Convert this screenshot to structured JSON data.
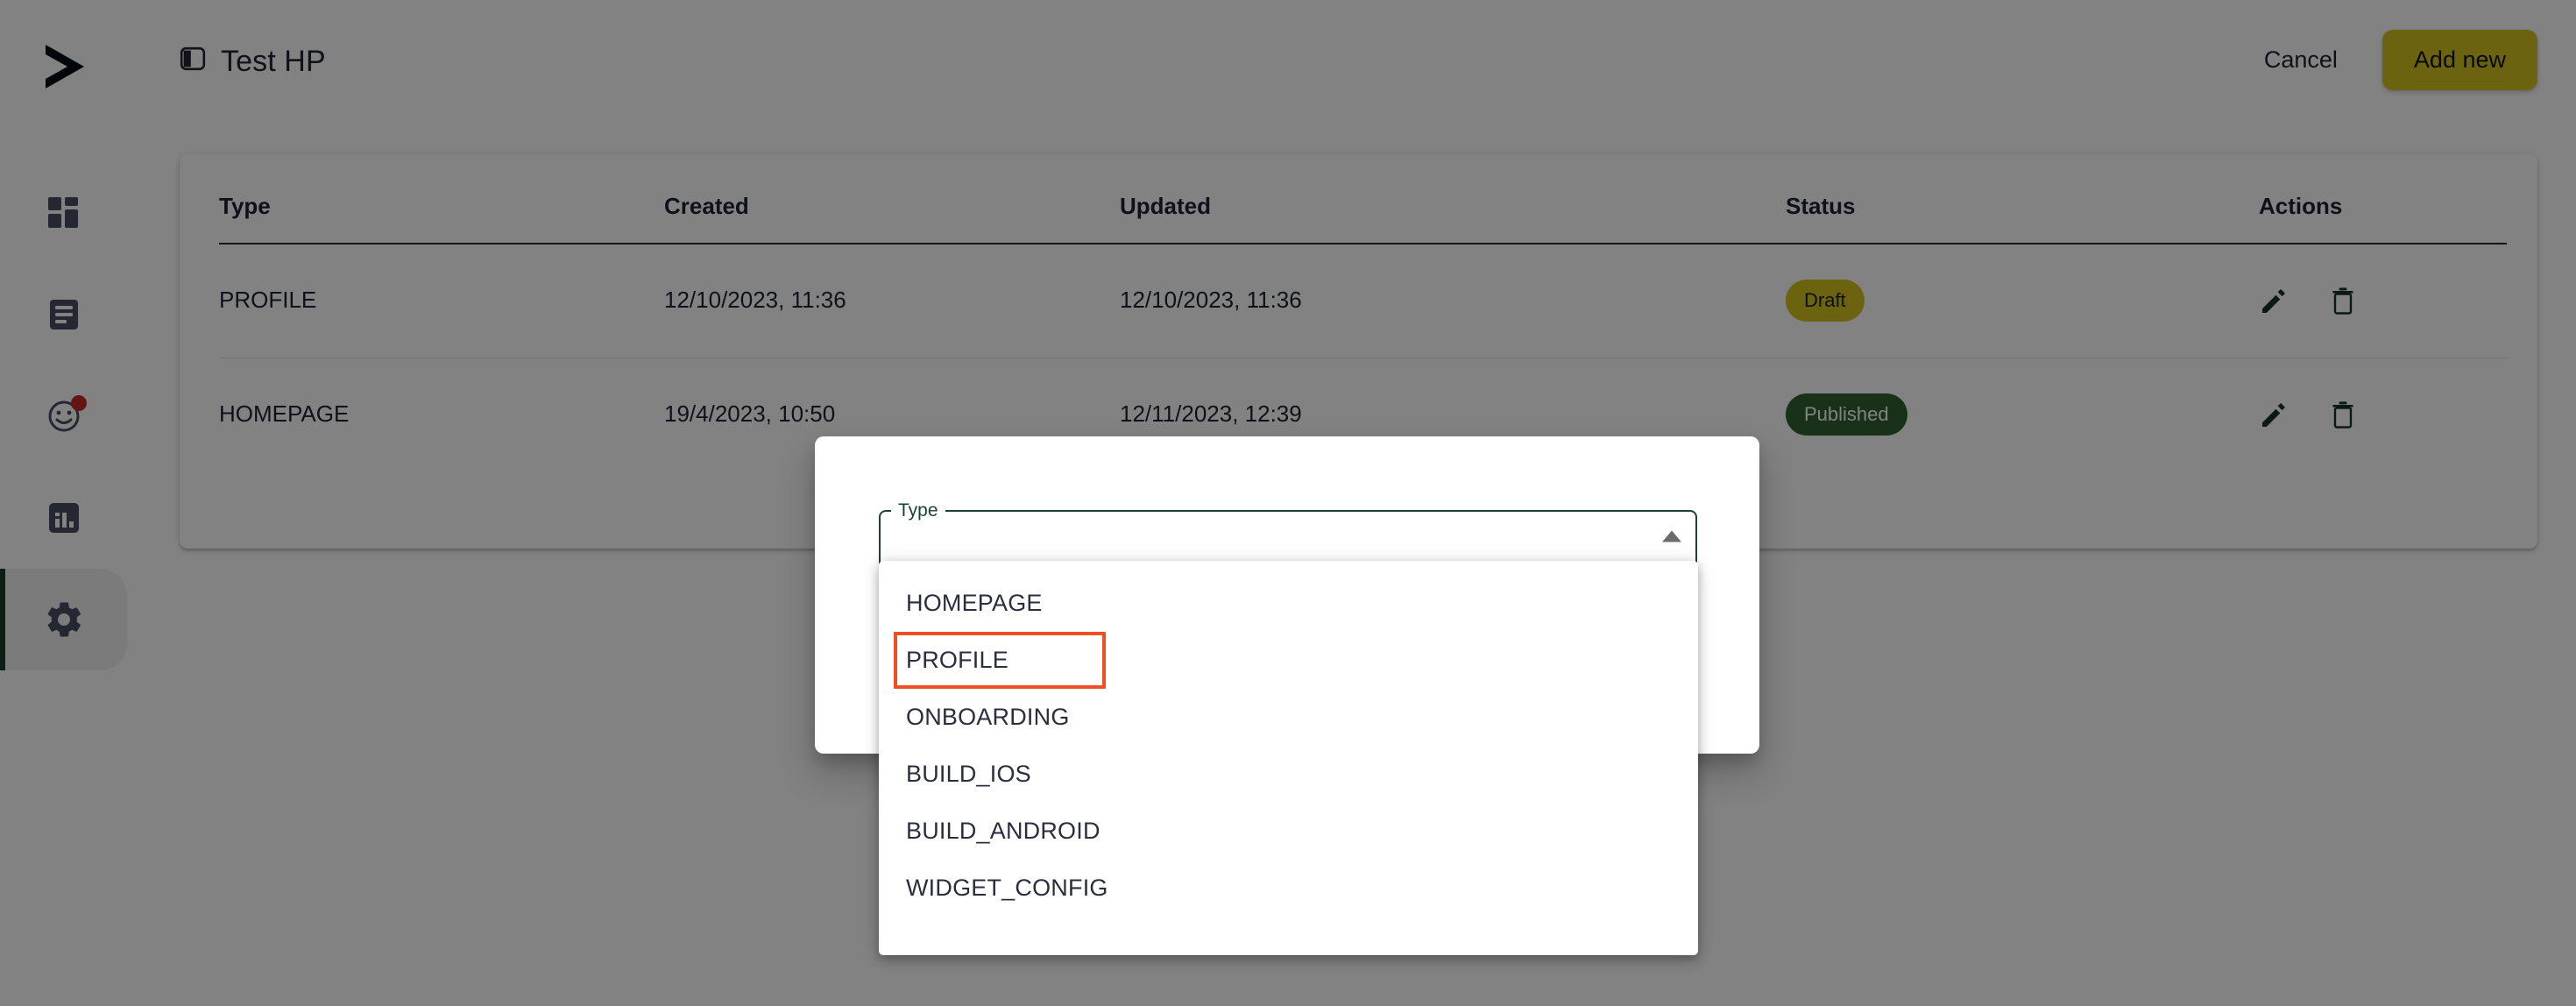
{
  "app": {
    "logo_icon": "play-triangle-logo"
  },
  "sidebar": {
    "items": [
      {
        "id": "dashboard",
        "icon": "dashboard-grid-icon",
        "active": false,
        "badge": false
      },
      {
        "id": "content",
        "icon": "article-document-icon",
        "active": false,
        "badge": false
      },
      {
        "id": "engagement",
        "icon": "smiley-face-icon",
        "active": false,
        "badge": true
      },
      {
        "id": "analytics",
        "icon": "bar-chart-icon",
        "active": false,
        "badge": false
      },
      {
        "id": "settings",
        "icon": "gear-icon",
        "active": true,
        "badge": false
      }
    ]
  },
  "header": {
    "panel_icon": "panel-left-icon",
    "title": "Test HP",
    "cancel_label": "Cancel",
    "add_new_label": "Add new"
  },
  "table": {
    "columns": [
      "Type",
      "Created",
      "Updated",
      "Status",
      "Actions"
    ],
    "rows": [
      {
        "type": "PROFILE",
        "created": "12/10/2023, 11:36",
        "updated": "12/10/2023, 11:36",
        "status": "Draft",
        "status_kind": "draft",
        "edit_icon": "pencil-icon",
        "delete_icon": "trash-icon"
      },
      {
        "type": "HOMEPAGE",
        "created": "19/4/2023, 10:50",
        "updated": "12/11/2023, 12:39",
        "status": "Published",
        "status_kind": "published",
        "edit_icon": "pencil-icon",
        "delete_icon": "trash-icon"
      }
    ]
  },
  "modal": {
    "type_field": {
      "label": "Type",
      "value": "",
      "placeholder": "",
      "arrow_icon": "chevron-up-icon"
    },
    "options": [
      {
        "label": "HOMEPAGE",
        "highlighted": false
      },
      {
        "label": "PROFILE",
        "highlighted": true
      },
      {
        "label": "ONBOARDING",
        "highlighted": false
      },
      {
        "label": "BUILD_IOS",
        "highlighted": false
      },
      {
        "label": "BUILD_ANDROID",
        "highlighted": false
      },
      {
        "label": "WIDGET_CONFIG",
        "highlighted": false
      }
    ]
  },
  "colors": {
    "accent_green": "#1b4332",
    "brand_yellow": "#d4c223",
    "published_green": "#2f6130",
    "badge_red": "#c62828",
    "highlight_orange": "#f04e23",
    "sidebar_icon": "#4a4d63"
  }
}
